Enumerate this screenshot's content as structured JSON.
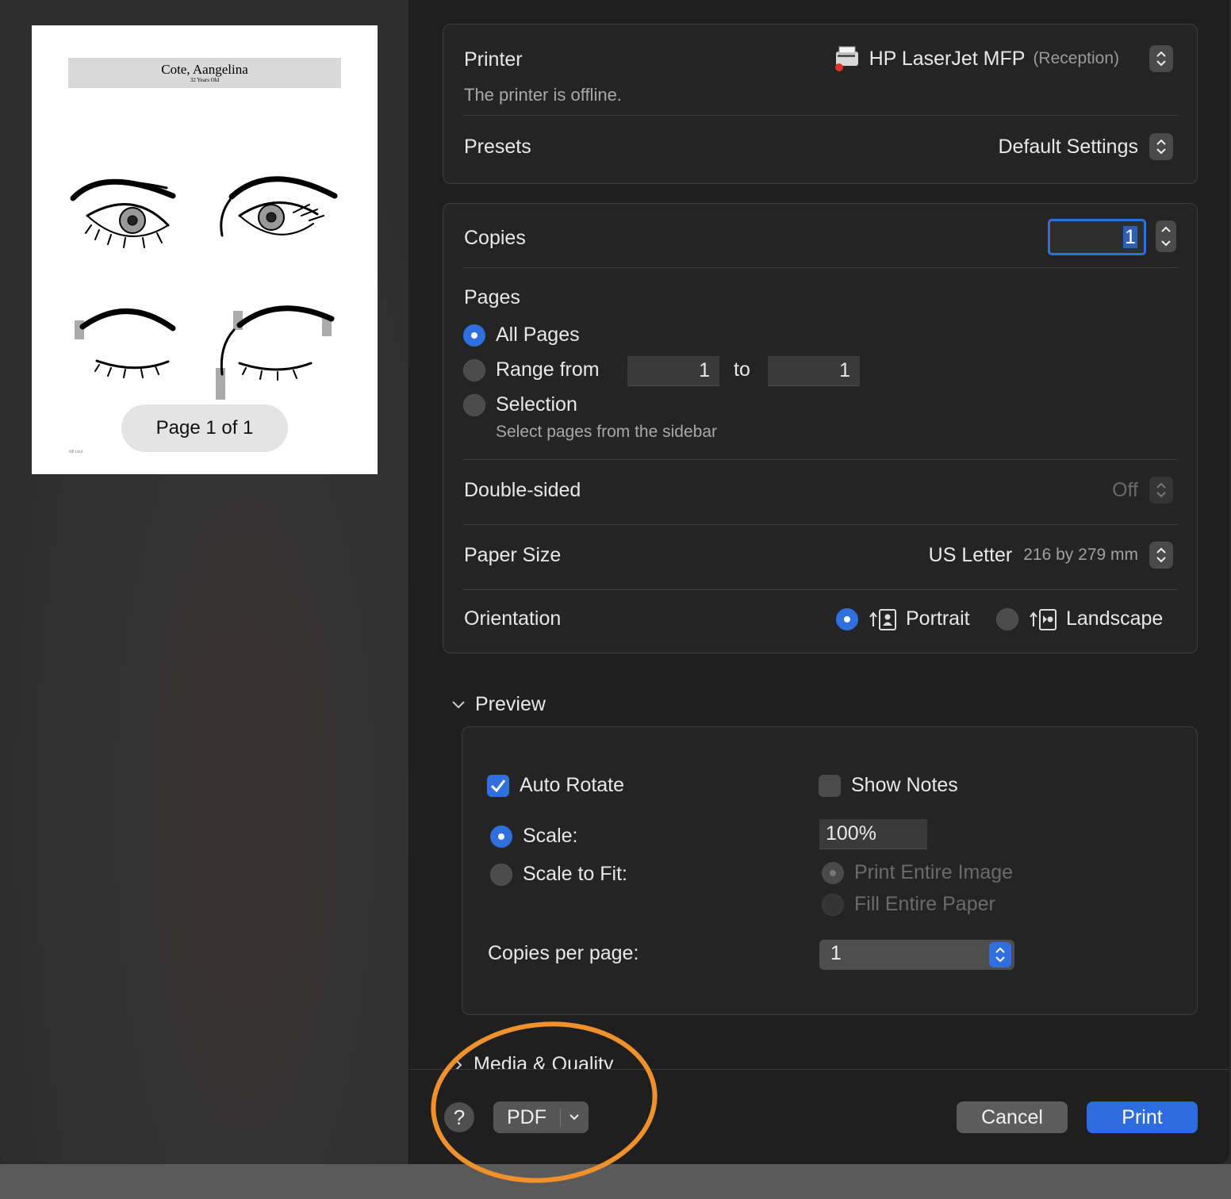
{
  "sidebar": {
    "thumbnail": {
      "name": "Cote, Aangelina",
      "subtitle": "32 Years Old",
      "footer": "NP 1414",
      "page_indicator": "Page 1 of 1"
    }
  },
  "printer_section": {
    "printer_label": "Printer",
    "printer_name": "HP LaserJet MFP",
    "printer_location": "(Reception)",
    "status": "The printer is offline.",
    "presets_label": "Presets",
    "presets_value": "Default Settings"
  },
  "copies_section": {
    "copies_label": "Copies",
    "copies_value": "1",
    "pages_label": "Pages",
    "all_pages": "All Pages",
    "range_from": "Range from",
    "range_start": "1",
    "range_to": "to",
    "range_end": "1",
    "selection": "Selection",
    "selection_hint": "Select pages from the sidebar",
    "pages_selected": "All Pages",
    "double_sided_label": "Double-sided",
    "double_sided_value": "Off",
    "paper_size_label": "Paper Size",
    "paper_size_value": "US Letter",
    "paper_size_dims": "216 by 279 mm",
    "orientation_label": "Orientation",
    "portrait": "Portrait",
    "landscape": "Landscape",
    "orientation_selected": "Portrait"
  },
  "preview_section": {
    "header": "Preview",
    "auto_rotate": "Auto Rotate",
    "auto_rotate_checked": true,
    "show_notes": "Show Notes",
    "show_notes_checked": false,
    "scale": "Scale:",
    "scale_value": "100%",
    "scale_to_fit": "Scale to Fit:",
    "print_entire_image": "Print Entire Image",
    "fill_entire_paper": "Fill Entire Paper",
    "copies_per_page": "Copies per page:",
    "copies_per_page_value": "1"
  },
  "collapsed_section": {
    "header": "Media & Quality"
  },
  "footer": {
    "help": "?",
    "pdf": "PDF",
    "cancel": "Cancel",
    "print": "Print"
  },
  "colors": {
    "accent": "#2c6be0",
    "annotation": "#f0912b"
  }
}
